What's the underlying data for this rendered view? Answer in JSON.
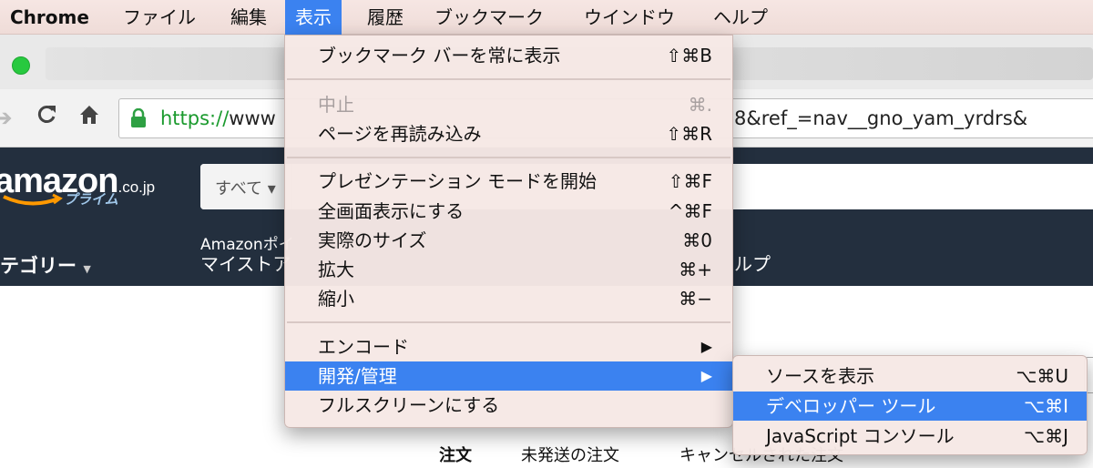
{
  "menubar": {
    "app": "Chrome",
    "items": [
      "ファイル",
      "編集",
      "表示",
      "履歴",
      "ブックマーク",
      "ウインドウ",
      "ヘルプ"
    ]
  },
  "browser": {
    "url_scheme": "https://",
    "url_host": "www",
    "url_rest": "8&ref_=nav__gno_yam_yrdrs&"
  },
  "icons": {
    "back": "back-arrow-icon",
    "reload": "reload-icon",
    "home": "home-icon",
    "lock": "lock-icon"
  },
  "amazon": {
    "logo": "amazon",
    "tld": ".co.jp",
    "prime": "プライム",
    "search_dept": "すべて",
    "category": "テゴリー",
    "points": "Amazonポイ",
    "mystore": "マイストア",
    "help": "ルプ"
  },
  "page_tabs": [
    "注文",
    "未発送の注文",
    "キャンセルされた注文"
  ],
  "view_menu": {
    "items": [
      {
        "label": "ブックマーク バーを常に表示",
        "shortcut": "⇧⌘B"
      },
      {
        "label": "中止",
        "shortcut": "⌘.",
        "disabled": true
      },
      {
        "label": "ページを再読み込み",
        "shortcut": "⇧⌘R"
      },
      {
        "label": "プレゼンテーション モードを開始",
        "shortcut": "⇧⌘F"
      },
      {
        "label": "全画面表示にする",
        "shortcut": "^⌘F"
      },
      {
        "label": "実際のサイズ",
        "shortcut": "⌘0"
      },
      {
        "label": "拡大",
        "shortcut": "⌘+"
      },
      {
        "label": "縮小",
        "shortcut": "⌘−"
      },
      {
        "label": "エンコード",
        "arrow": "▶"
      },
      {
        "label": "開発/管理",
        "arrow": "▶",
        "highlighted": true
      },
      {
        "label": "フルスクリーンにする"
      }
    ]
  },
  "dev_menu": {
    "items": [
      {
        "label": "ソースを表示",
        "shortcut": "⌥⌘U"
      },
      {
        "label": "デベロッパー ツール",
        "shortcut": "⌥⌘I",
        "highlighted": true
      },
      {
        "label": "JavaScript コンソール",
        "shortcut": "⌥⌘J"
      }
    ]
  },
  "colors": {
    "highlight": "#3b82f0",
    "amazon_nav": "#232f3e",
    "url_green": "#1a9a2d",
    "menubar_bg": "#f6e6e3"
  }
}
